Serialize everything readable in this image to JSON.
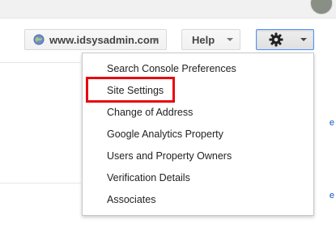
{
  "header": {
    "site_selector": {
      "label": "www.idsysadmin.com",
      "icon": "globe-icon"
    },
    "help_button": {
      "label": "Help"
    },
    "settings_button": {
      "icon": "gear-icon"
    }
  },
  "settings_menu": {
    "items": [
      {
        "label": "Search Console Preferences"
      },
      {
        "label": "Site Settings",
        "highlighted": true
      },
      {
        "label": "Change of Address"
      },
      {
        "label": "Google Analytics Property"
      },
      {
        "label": "Users and Property Owners"
      },
      {
        "label": "Verification Details"
      },
      {
        "label": "Associates"
      }
    ]
  },
  "partial_glyphs": [
    "e",
    "e"
  ],
  "colors": {
    "highlight_border": "#e8070e",
    "active_button_border": "#4d90fe",
    "text": "#222222"
  }
}
